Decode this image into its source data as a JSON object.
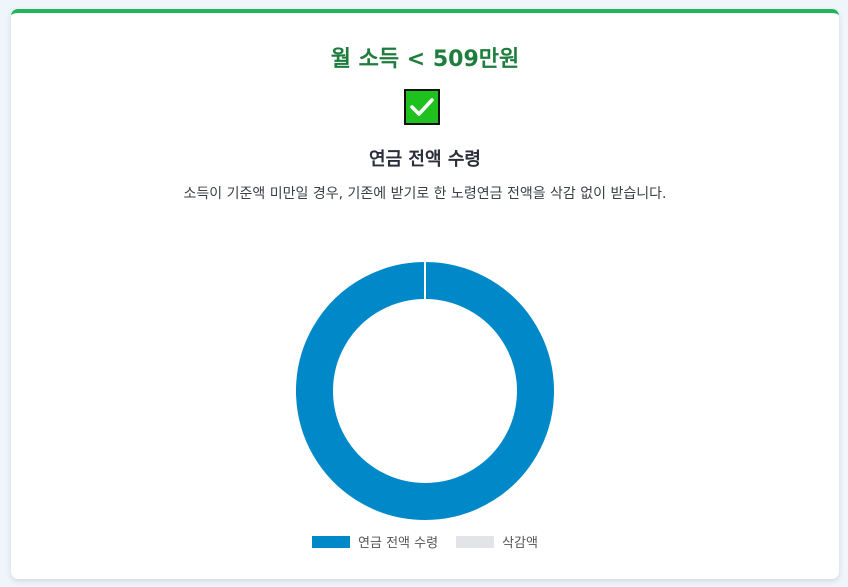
{
  "card": {
    "title": "월 소득 < 509만원",
    "check_icon": "check-icon",
    "subtitle": "연금 전액 수령",
    "description": "소득이 기준액 미만일 경우, 기존에 받기로 한 노령연금 전액을 삭감 없이 받습니다."
  },
  "colors": {
    "accent_top": "#22b45a",
    "title": "#1e7d3c",
    "check_bg": "#1fc11f"
  },
  "chart_data": {
    "type": "pie",
    "donut": true,
    "labels": [
      "연금 전액 수령",
      "삭감액"
    ],
    "values": [
      100,
      0
    ],
    "colors": [
      "#0088c8",
      "#e2e4e8"
    ],
    "legend_position": "bottom"
  }
}
